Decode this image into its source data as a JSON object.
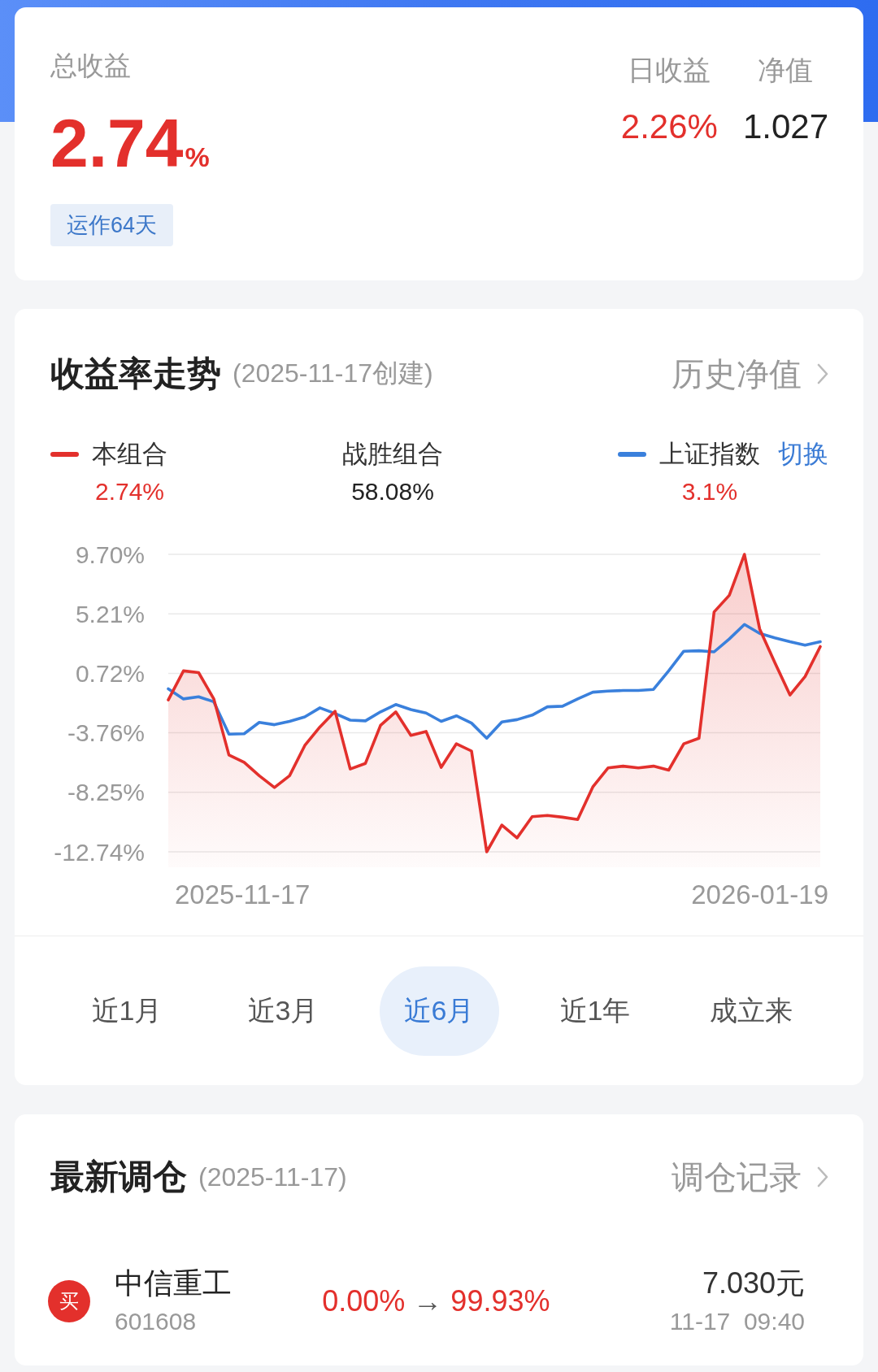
{
  "summary": {
    "label": "总收益",
    "value": "2.74",
    "unit": "%",
    "gain": true,
    "badge": "运作64天",
    "stats": [
      {
        "label": "日收益",
        "value": "2.26%",
        "gain": true
      },
      {
        "label": "净值",
        "value": "1.027",
        "gain": false
      }
    ]
  },
  "trend": {
    "title": "收益率走势",
    "note": "(2025-11-17创建)",
    "link": "历史净值",
    "legend": [
      {
        "kind": "series",
        "value": "2.74%",
        "gain": true
      },
      {
        "kind": "stat",
        "label": "战胜组合",
        "value": "58.08%",
        "gain": false
      },
      {
        "kind": "series",
        "value": "3.1%",
        "gain": true,
        "action": "切换"
      }
    ],
    "chart_data": {
      "type": "line",
      "grid": true,
      "ylim": [
        -12.74,
        9.7
      ],
      "yticks": [
        {
          "value": 9.7,
          "label": "9.70%"
        },
        {
          "value": 5.21,
          "label": "5.21%"
        },
        {
          "value": 0.72,
          "label": "0.72%"
        },
        {
          "value": -3.76,
          "label": "-3.76%"
        },
        {
          "value": -8.25,
          "label": "-8.25%"
        },
        {
          "value": -12.74,
          "label": "-12.74%"
        }
      ],
      "series": [
        {
          "name": "本组合",
          "type": "area",
          "color": "#e3302c",
          "values": [
            -1.29,
            0.91,
            0.78,
            -1.21,
            -5.44,
            -5.99,
            -7.0,
            -7.89,
            -7.0,
            -4.72,
            -3.32,
            -2.14,
            -6.49,
            -6.07,
            -3.2,
            -2.18,
            -3.96,
            -3.66,
            -6.37,
            -4.59,
            -5.14,
            -12.74,
            -10.72,
            -11.69,
            -10.09,
            -10.0,
            -10.13,
            -10.3,
            -7.85,
            -6.41,
            -6.28,
            -6.41,
            -6.28,
            -6.58,
            -4.59,
            -4.17,
            5.35,
            6.61,
            9.7,
            4.08,
            1.54,
            -0.91,
            0.48,
            2.74
          ]
        },
        {
          "name": "上证指数",
          "type": "line",
          "color": "#3a80dc",
          "values": [
            -0.45,
            -1.21,
            -1.04,
            -1.42,
            -3.87,
            -3.83,
            -2.98,
            -3.15,
            -2.9,
            -2.56,
            -1.88,
            -2.31,
            -2.81,
            -2.86,
            -2.18,
            -1.63,
            -2.01,
            -2.27,
            -2.9,
            -2.48,
            -3.03,
            -4.17,
            -2.94,
            -2.77,
            -2.43,
            -1.8,
            -1.76,
            -1.21,
            -0.7,
            -0.62,
            -0.57,
            -0.57,
            -0.49,
            0.91,
            2.39,
            2.43,
            2.34,
            3.32,
            4.41,
            3.74,
            3.4,
            3.1,
            2.85,
            3.1
          ]
        }
      ]
    },
    "date_labels": [
      "2025-11-17",
      "2026-01-19"
    ],
    "periods": [
      {
        "label": "近1月",
        "selected": false
      },
      {
        "label": "近3月",
        "selected": false
      },
      {
        "label": "近6月",
        "selected": true
      },
      {
        "label": "近1年",
        "selected": false
      },
      {
        "label": "成立来",
        "selected": false
      }
    ]
  },
  "rebalance": {
    "title": "最新调仓",
    "note": "(2025-11-17)",
    "link": "调仓记录",
    "trades": [
      {
        "kind": "buy",
        "badge": "买",
        "name": "中信重工",
        "code": "601608",
        "from": "0.00%",
        "arrow": "→",
        "to": "99.93%",
        "price": "7.030元",
        "time": "11-17  09:40"
      }
    ]
  }
}
